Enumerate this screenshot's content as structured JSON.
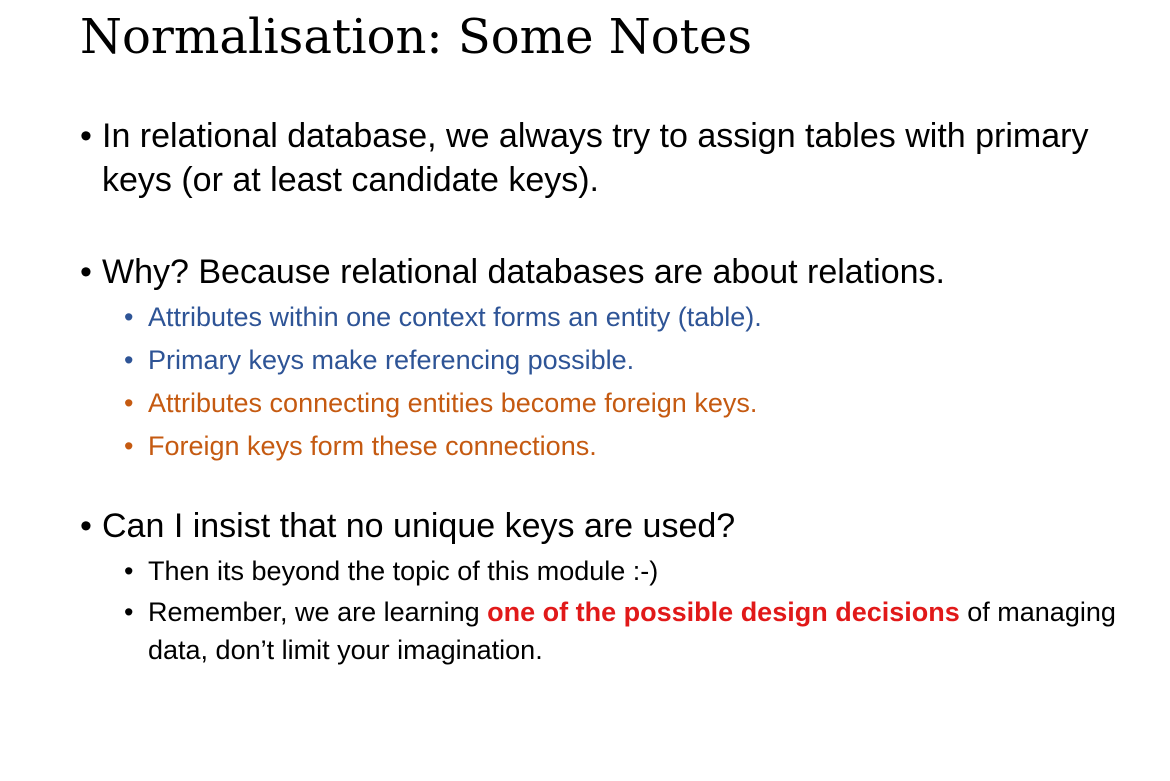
{
  "slide": {
    "title": "Normalisation: Some Notes",
    "bullet_char": "•",
    "colors": {
      "text": "#000000",
      "blue": "#2e5496",
      "orange": "#c55a11",
      "highlight": "#e11919"
    },
    "bullets": [
      {
        "text": "In relational database, we always try to assign tables with primary keys (or at least candidate keys)."
      },
      {
        "text": "Why? Because relational databases are about relations.",
        "sub": [
          "Attributes within one context forms an entity (table).",
          "Primary keys make referencing possible.",
          "Attributes connecting entities become foreign keys.",
          "Foreign keys form these connections."
        ]
      },
      {
        "text": "Can I insist that no unique keys are used?",
        "sub": [
          "Then its beyond the topic of this module :-)"
        ],
        "last_sub": {
          "before": "Remember, we are learning ",
          "highlight": "one of the possible design decisions",
          "after": " of managing data, don’t limit your imagination."
        }
      }
    ]
  }
}
